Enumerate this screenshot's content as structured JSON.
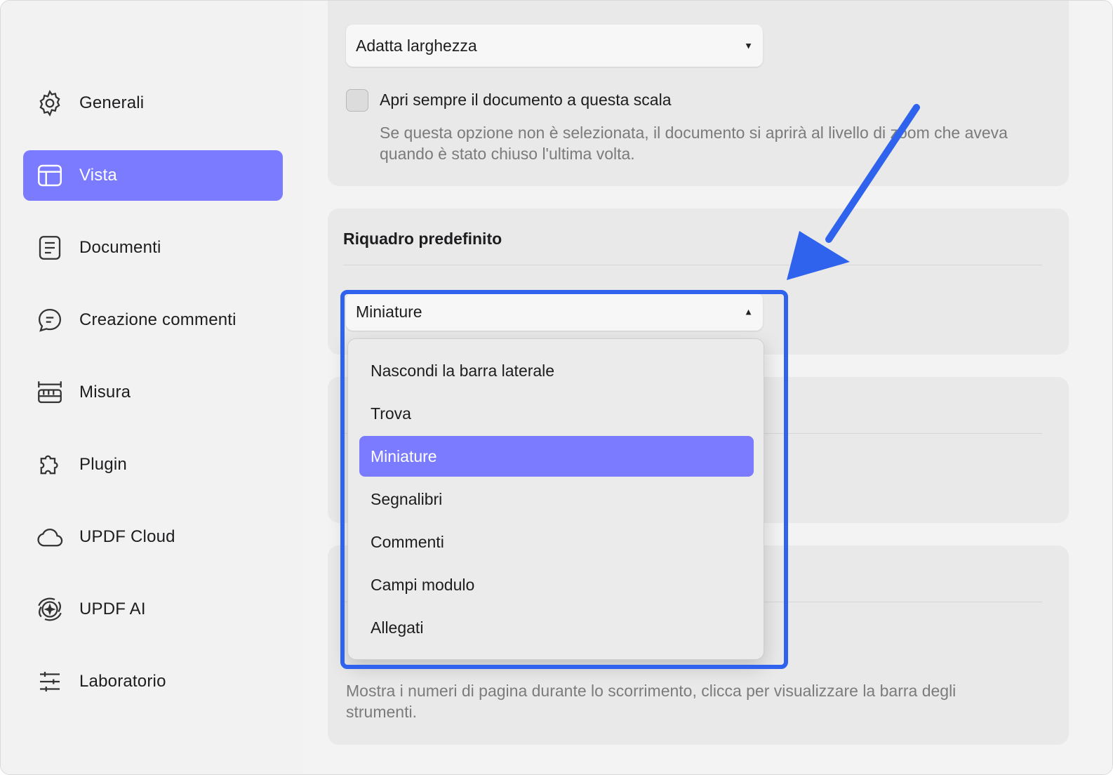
{
  "sidebar": {
    "items": [
      {
        "label": "Generali",
        "icon": "gear-icon"
      },
      {
        "label": "Vista",
        "icon": "layout-icon",
        "active": true
      },
      {
        "label": "Documenti",
        "icon": "document-icon"
      },
      {
        "label": "Creazione commenti",
        "icon": "comment-icon"
      },
      {
        "label": "Misura",
        "icon": "ruler-icon"
      },
      {
        "label": "Plugin",
        "icon": "puzzle-icon"
      },
      {
        "label": "UPDF Cloud",
        "icon": "cloud-icon"
      },
      {
        "label": "UPDF AI",
        "icon": "ai-icon"
      },
      {
        "label": "Laboratorio",
        "icon": "sliders-icon"
      }
    ]
  },
  "zoom": {
    "select_value": "Adatta larghezza",
    "checkbox_label": "Apri sempre il documento a questa scala",
    "checkbox_checked": false,
    "description": "Se questa opzione non è selezionata, il documento si aprirà al livello di zoom che aveva quando è stato chiuso l'ultima volta."
  },
  "default_pane": {
    "title": "Riquadro predefinito",
    "select_value": "Miniature",
    "options": [
      "Nascondi la barra laterale",
      "Trova",
      "Miniature",
      "Segnalibri",
      "Commenti",
      "Campi modulo",
      "Allegati"
    ],
    "selected_option": "Miniature"
  },
  "page_numbers": {
    "description": "Mostra i numeri di pagina durante lo scorrimento, clicca per visualizzare la barra degli strumenti."
  },
  "colors": {
    "accent": "#7b7bff",
    "annotation": "#2f63ee"
  }
}
